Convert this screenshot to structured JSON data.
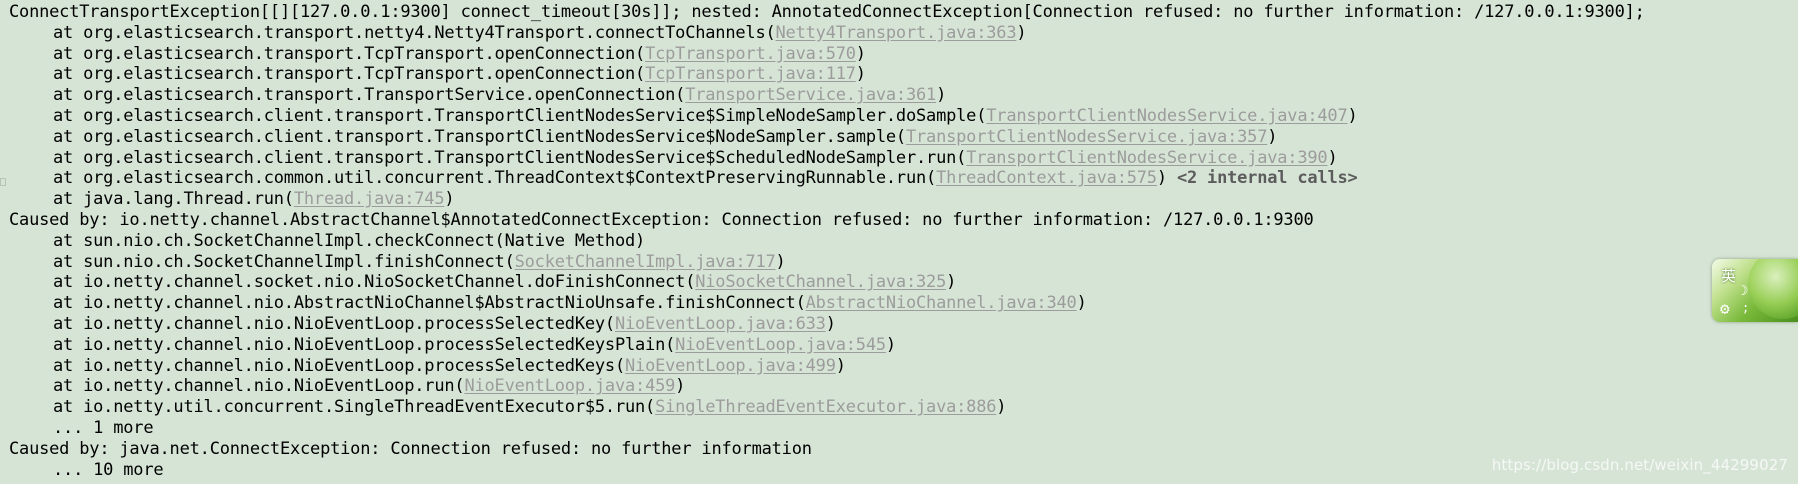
{
  "console": {
    "lines": [
      {
        "indent": false,
        "parts": [
          {
            "t": "ConnectTransportException[[][127.0.0.1:9300] connect_timeout[30s]]; nested: AnnotatedConnectException[Connection refused: no further information: /127.0.0.1:9300];"
          }
        ]
      },
      {
        "indent": true,
        "parts": [
          {
            "t": "at org.elasticsearch.transport.netty4.Netty4Transport.connectToChannels("
          },
          {
            "t": "Netty4Transport.java:363",
            "link": true
          },
          {
            "t": ")"
          }
        ]
      },
      {
        "indent": true,
        "parts": [
          {
            "t": "at org.elasticsearch.transport.TcpTransport.openConnection("
          },
          {
            "t": "TcpTransport.java:570",
            "link": true
          },
          {
            "t": ")"
          }
        ]
      },
      {
        "indent": true,
        "parts": [
          {
            "t": "at org.elasticsearch.transport.TcpTransport.openConnection("
          },
          {
            "t": "TcpTransport.java:117",
            "link": true
          },
          {
            "t": ")"
          }
        ]
      },
      {
        "indent": true,
        "parts": [
          {
            "t": "at org.elasticsearch.transport.TransportService.openConnection("
          },
          {
            "t": "TransportService.java:361",
            "link": true
          },
          {
            "t": ")"
          }
        ]
      },
      {
        "indent": true,
        "parts": [
          {
            "t": "at org.elasticsearch.client.transport.TransportClientNodesService$SimpleNodeSampler.doSample("
          },
          {
            "t": "TransportClientNodesService.java:407",
            "link": true
          },
          {
            "t": ")"
          }
        ]
      },
      {
        "indent": true,
        "parts": [
          {
            "t": "at org.elasticsearch.client.transport.TransportClientNodesService$NodeSampler.sample("
          },
          {
            "t": "TransportClientNodesService.java:357",
            "link": true
          },
          {
            "t": ")"
          }
        ]
      },
      {
        "indent": true,
        "parts": [
          {
            "t": "at org.elasticsearch.client.transport.TransportClientNodesService$ScheduledNodeSampler.run("
          },
          {
            "t": "TransportClientNodesService.java:390",
            "link": true
          },
          {
            "t": ")"
          }
        ]
      },
      {
        "indent": true,
        "parts": [
          {
            "t": "at org.elasticsearch.common.util.concurrent.ThreadContext$ContextPreservingRunnable.run("
          },
          {
            "t": "ThreadContext.java:575",
            "link": true
          },
          {
            "t": ") "
          },
          {
            "t": "<2 internal calls>",
            "strong": true
          }
        ]
      },
      {
        "indent": true,
        "parts": [
          {
            "t": "at java.lang.Thread.run("
          },
          {
            "t": "Thread.java:745",
            "link": true
          },
          {
            "t": ")"
          }
        ]
      },
      {
        "indent": false,
        "parts": [
          {
            "t": "Caused by: io.netty.channel.AbstractChannel$AnnotatedConnectException: Connection refused: no further information: /127.0.0.1:9300"
          }
        ]
      },
      {
        "indent": true,
        "parts": [
          {
            "t": "at sun.nio.ch.SocketChannelImpl.checkConnect(Native Method)"
          }
        ]
      },
      {
        "indent": true,
        "parts": [
          {
            "t": "at sun.nio.ch.SocketChannelImpl.finishConnect("
          },
          {
            "t": "SocketChannelImpl.java:717",
            "link": true
          },
          {
            "t": ")"
          }
        ]
      },
      {
        "indent": true,
        "parts": [
          {
            "t": "at io.netty.channel.socket.nio.NioSocketChannel.doFinishConnect("
          },
          {
            "t": "NioSocketChannel.java:325",
            "link": true
          },
          {
            "t": ")"
          }
        ]
      },
      {
        "indent": true,
        "parts": [
          {
            "t": "at io.netty.channel.nio.AbstractNioChannel$AbstractNioUnsafe.finishConnect("
          },
          {
            "t": "AbstractNioChannel.java:340",
            "link": true
          },
          {
            "t": ")"
          }
        ]
      },
      {
        "indent": true,
        "parts": [
          {
            "t": "at io.netty.channel.nio.NioEventLoop.processSelectedKey("
          },
          {
            "t": "NioEventLoop.java:633",
            "link": true
          },
          {
            "t": ")"
          }
        ]
      },
      {
        "indent": true,
        "parts": [
          {
            "t": "at io.netty.channel.nio.NioEventLoop.processSelectedKeysPlain("
          },
          {
            "t": "NioEventLoop.java:545",
            "link": true
          },
          {
            "t": ")"
          }
        ]
      },
      {
        "indent": true,
        "parts": [
          {
            "t": "at io.netty.channel.nio.NioEventLoop.processSelectedKeys("
          },
          {
            "t": "NioEventLoop.java:499",
            "link": true
          },
          {
            "t": ")"
          }
        ]
      },
      {
        "indent": true,
        "parts": [
          {
            "t": "at io.netty.channel.nio.NioEventLoop.run("
          },
          {
            "t": "NioEventLoop.java:459",
            "link": true
          },
          {
            "t": ")"
          }
        ]
      },
      {
        "indent": true,
        "parts": [
          {
            "t": "at io.netty.util.concurrent.SingleThreadEventExecutor$5.run("
          },
          {
            "t": "SingleThreadEventExecutor.java:886",
            "link": true
          },
          {
            "t": ")"
          }
        ]
      },
      {
        "indent": true,
        "parts": [
          {
            "t": "... 1 more"
          }
        ]
      },
      {
        "indent": false,
        "parts": [
          {
            "t": "Caused by: java.net.ConnectException: Connection refused: no further information"
          }
        ]
      },
      {
        "indent": true,
        "parts": [
          {
            "t": "... 10 more"
          }
        ]
      }
    ]
  },
  "ime": {
    "language": "英",
    "mode_icon": "moon-icon",
    "settings_icon": "gear-icon",
    "punct_icon": "punctuation-icon"
  },
  "watermark": "https://blog.csdn.net/weixin_44299027",
  "colors": {
    "background": "#d6e4d6",
    "text": "#000000",
    "link": "#9c9c9c",
    "internal_calls": "#5c5c5c"
  }
}
